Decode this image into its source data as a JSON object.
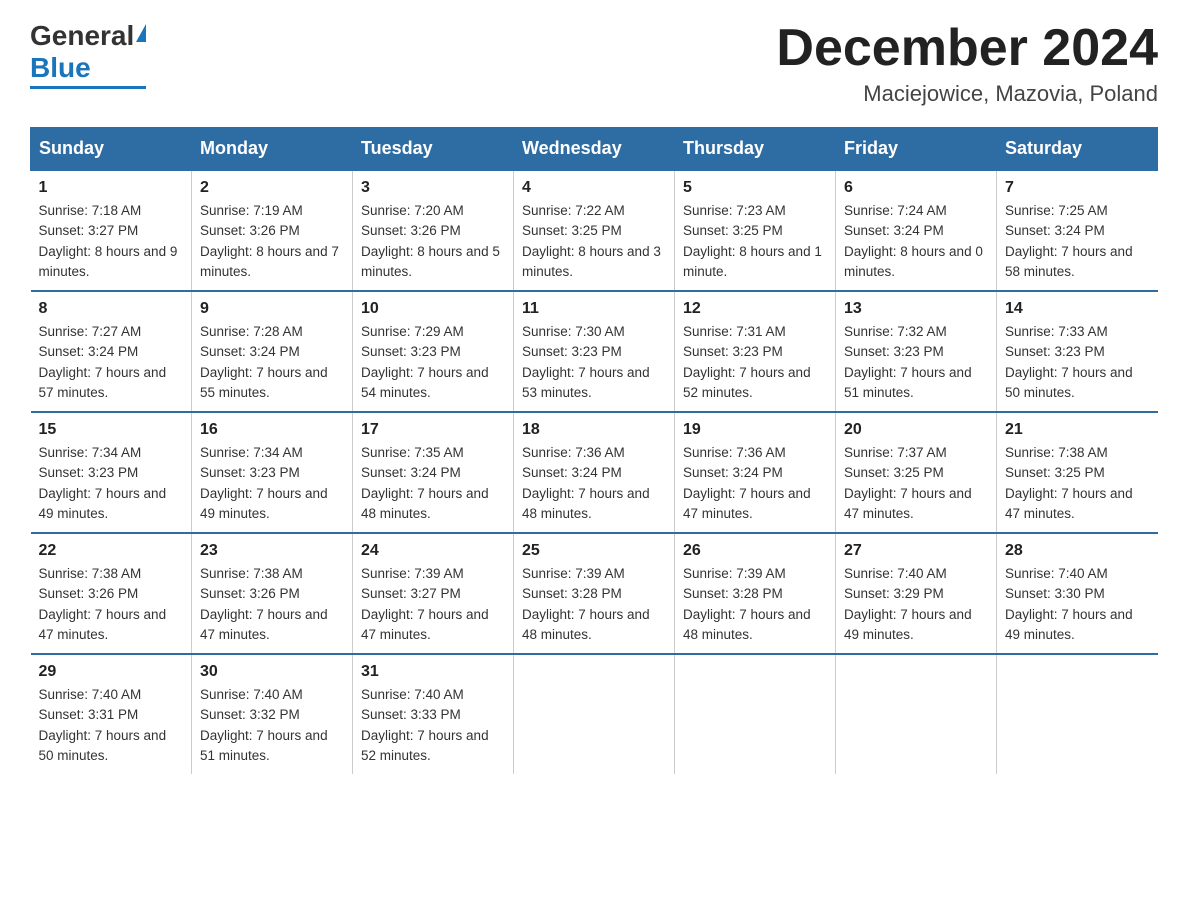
{
  "logo": {
    "general": "General",
    "blue": "Blue",
    "line": true
  },
  "title": "December 2024",
  "location": "Maciejowice, Mazovia, Poland",
  "days_of_week": [
    "Sunday",
    "Monday",
    "Tuesday",
    "Wednesday",
    "Thursday",
    "Friday",
    "Saturday"
  ],
  "weeks": [
    [
      {
        "day": "1",
        "sunrise": "7:18 AM",
        "sunset": "3:27 PM",
        "daylight": "8 hours and 9 minutes."
      },
      {
        "day": "2",
        "sunrise": "7:19 AM",
        "sunset": "3:26 PM",
        "daylight": "8 hours and 7 minutes."
      },
      {
        "day": "3",
        "sunrise": "7:20 AM",
        "sunset": "3:26 PM",
        "daylight": "8 hours and 5 minutes."
      },
      {
        "day": "4",
        "sunrise": "7:22 AM",
        "sunset": "3:25 PM",
        "daylight": "8 hours and 3 minutes."
      },
      {
        "day": "5",
        "sunrise": "7:23 AM",
        "sunset": "3:25 PM",
        "daylight": "8 hours and 1 minute."
      },
      {
        "day": "6",
        "sunrise": "7:24 AM",
        "sunset": "3:24 PM",
        "daylight": "8 hours and 0 minutes."
      },
      {
        "day": "7",
        "sunrise": "7:25 AM",
        "sunset": "3:24 PM",
        "daylight": "7 hours and 58 minutes."
      }
    ],
    [
      {
        "day": "8",
        "sunrise": "7:27 AM",
        "sunset": "3:24 PM",
        "daylight": "7 hours and 57 minutes."
      },
      {
        "day": "9",
        "sunrise": "7:28 AM",
        "sunset": "3:24 PM",
        "daylight": "7 hours and 55 minutes."
      },
      {
        "day": "10",
        "sunrise": "7:29 AM",
        "sunset": "3:23 PM",
        "daylight": "7 hours and 54 minutes."
      },
      {
        "day": "11",
        "sunrise": "7:30 AM",
        "sunset": "3:23 PM",
        "daylight": "7 hours and 53 minutes."
      },
      {
        "day": "12",
        "sunrise": "7:31 AM",
        "sunset": "3:23 PM",
        "daylight": "7 hours and 52 minutes."
      },
      {
        "day": "13",
        "sunrise": "7:32 AM",
        "sunset": "3:23 PM",
        "daylight": "7 hours and 51 minutes."
      },
      {
        "day": "14",
        "sunrise": "7:33 AM",
        "sunset": "3:23 PM",
        "daylight": "7 hours and 50 minutes."
      }
    ],
    [
      {
        "day": "15",
        "sunrise": "7:34 AM",
        "sunset": "3:23 PM",
        "daylight": "7 hours and 49 minutes."
      },
      {
        "day": "16",
        "sunrise": "7:34 AM",
        "sunset": "3:23 PM",
        "daylight": "7 hours and 49 minutes."
      },
      {
        "day": "17",
        "sunrise": "7:35 AM",
        "sunset": "3:24 PM",
        "daylight": "7 hours and 48 minutes."
      },
      {
        "day": "18",
        "sunrise": "7:36 AM",
        "sunset": "3:24 PM",
        "daylight": "7 hours and 48 minutes."
      },
      {
        "day": "19",
        "sunrise": "7:36 AM",
        "sunset": "3:24 PM",
        "daylight": "7 hours and 47 minutes."
      },
      {
        "day": "20",
        "sunrise": "7:37 AM",
        "sunset": "3:25 PM",
        "daylight": "7 hours and 47 minutes."
      },
      {
        "day": "21",
        "sunrise": "7:38 AM",
        "sunset": "3:25 PM",
        "daylight": "7 hours and 47 minutes."
      }
    ],
    [
      {
        "day": "22",
        "sunrise": "7:38 AM",
        "sunset": "3:26 PM",
        "daylight": "7 hours and 47 minutes."
      },
      {
        "day": "23",
        "sunrise": "7:38 AM",
        "sunset": "3:26 PM",
        "daylight": "7 hours and 47 minutes."
      },
      {
        "day": "24",
        "sunrise": "7:39 AM",
        "sunset": "3:27 PM",
        "daylight": "7 hours and 47 minutes."
      },
      {
        "day": "25",
        "sunrise": "7:39 AM",
        "sunset": "3:28 PM",
        "daylight": "7 hours and 48 minutes."
      },
      {
        "day": "26",
        "sunrise": "7:39 AM",
        "sunset": "3:28 PM",
        "daylight": "7 hours and 48 minutes."
      },
      {
        "day": "27",
        "sunrise": "7:40 AM",
        "sunset": "3:29 PM",
        "daylight": "7 hours and 49 minutes."
      },
      {
        "day": "28",
        "sunrise": "7:40 AM",
        "sunset": "3:30 PM",
        "daylight": "7 hours and 49 minutes."
      }
    ],
    [
      {
        "day": "29",
        "sunrise": "7:40 AM",
        "sunset": "3:31 PM",
        "daylight": "7 hours and 50 minutes."
      },
      {
        "day": "30",
        "sunrise": "7:40 AM",
        "sunset": "3:32 PM",
        "daylight": "7 hours and 51 minutes."
      },
      {
        "day": "31",
        "sunrise": "7:40 AM",
        "sunset": "3:33 PM",
        "daylight": "7 hours and 52 minutes."
      },
      null,
      null,
      null,
      null
    ]
  ]
}
